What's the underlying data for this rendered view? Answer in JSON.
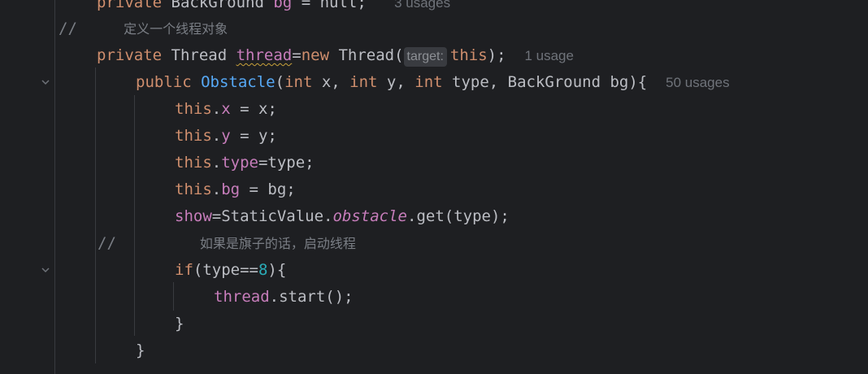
{
  "code": {
    "line0": {
      "kw": "private",
      "type": " BackGround",
      "field": " bg",
      "rest": " = null;",
      "usage": "3 usages"
    },
    "line1": {
      "slashes": "//",
      "comment": "定义一个线程对象"
    },
    "line2": {
      "kw": "private",
      "type": " Thread ",
      "field": "thread",
      "eq": "=",
      "new_kw": "new",
      "ctor": " Thread(",
      "hint": "target:",
      "this_kw": "this",
      "end": ");",
      "usage": "1 usage"
    },
    "line3": {
      "kw": "public",
      "name": "Obstacle",
      "p1": "(",
      "int1": "int",
      "p2": " x, ",
      "int2": "int",
      "p3": " y, ",
      "int3": "int",
      "p4": " type, BackGround bg){",
      "usage": "50 usages"
    },
    "line4": {
      "this_kw": "this",
      "dot": ".",
      "field": "x",
      "rest": " = x;"
    },
    "line5": {
      "this_kw": "this",
      "dot": ".",
      "field": "y",
      "rest": " = y;"
    },
    "line6": {
      "this_kw": "this",
      "dot": ".",
      "field": "type",
      "rest": "=type;"
    },
    "line7": {
      "this_kw": "this",
      "dot": ".",
      "field": "bg",
      "rest": " = bg;"
    },
    "line8": {
      "field": "show",
      "a": "=StaticValue.",
      "static_field": "obstacle",
      "b": ".get(type);"
    },
    "line9": {
      "slashes": "//",
      "comment": "如果是旗子的话，启动线程"
    },
    "line10": {
      "kw": "if",
      "a": "(type==",
      "num": "8",
      "b": "){"
    },
    "line11": {
      "field": "thread",
      "rest": ".start();"
    },
    "line12": {
      "brace": "}"
    },
    "line13": {
      "brace": "}"
    },
    "icons": {
      "fold": "chevron-down-icon"
    },
    "colors": {
      "background": "#1e1f22",
      "keyword": "#cf8e6d",
      "method": "#56a8f5",
      "field": "#c77dbb",
      "number": "#2aacb8",
      "comment": "#7a7e85",
      "text": "#bcbec4"
    }
  }
}
